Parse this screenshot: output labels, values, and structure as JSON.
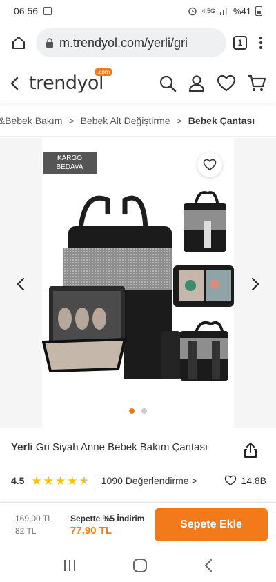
{
  "status": {
    "time": "06:56",
    "signal": "4,5G",
    "battery": "%41"
  },
  "browser": {
    "url": "m.trendyol.com/yerli/gri",
    "tab_count": "1"
  },
  "header": {
    "logo": "trendyol",
    "logo_com": ".com"
  },
  "breadcrumb": {
    "items": [
      "e&Bebek Bakım",
      "Bebek Alt Değiştirme"
    ],
    "current": "Bebek Çantası"
  },
  "gallery": {
    "badge_line1": "KARGO",
    "badge_line2": "BEDAVA",
    "slide_count": 2,
    "active_slide": 0
  },
  "product": {
    "brand": "Yerli",
    "name": "Gri Siyah Anne Bebek Bakım Çantası"
  },
  "rating": {
    "score": "4.5",
    "stars": 4.5,
    "count": "1090",
    "count_label": "Değerlendirme",
    "favorites": "14.8B"
  },
  "purchase": {
    "old_price": "169,00 TL",
    "price": "82 TL",
    "discount_label": "Sepette %5 İndirim",
    "discount_price": "77,90 TL",
    "cart_button": "Sepete Ekle"
  },
  "colors": {
    "accent": "#f27a1a",
    "star": "#ffc000"
  }
}
